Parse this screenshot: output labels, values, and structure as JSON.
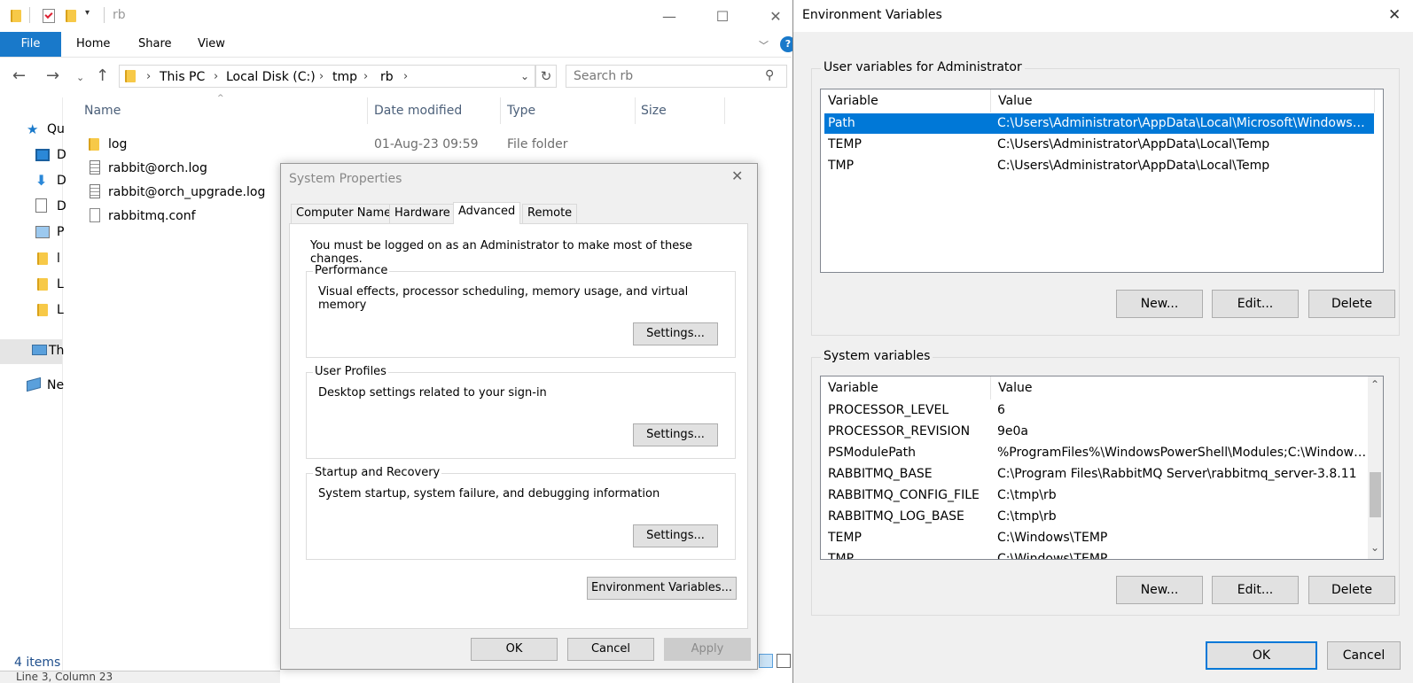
{
  "explorer": {
    "title": "rb",
    "ribbon_tabs": [
      "File",
      "Home",
      "Share",
      "View"
    ],
    "help_icon": "?",
    "breadcrumbs": [
      "This PC",
      "Local Disk (C:)",
      "tmp",
      "rb"
    ],
    "search_placeholder": "Search rb",
    "columns": [
      "Name",
      "Date modified",
      "Type",
      "Size"
    ],
    "files": [
      {
        "name": "log",
        "date": "01-Aug-23 09:59",
        "type": "File folder",
        "icon": "folder-icon"
      },
      {
        "name": "rabbit@orch.log",
        "date": "",
        "type": "",
        "icon": "text-file-icon"
      },
      {
        "name": "rabbit@orch_upgrade.log",
        "date": "",
        "type": "",
        "icon": "text-file-icon"
      },
      {
        "name": "rabbitmq.conf",
        "date": "",
        "type": "",
        "icon": "blank-file-icon"
      }
    ],
    "nav_items": [
      {
        "label": "Qu",
        "icon": "star-icon"
      },
      {
        "label": "D",
        "icon": "desktop-icon"
      },
      {
        "label": "D",
        "icon": "download-icon"
      },
      {
        "label": "D",
        "icon": "document-icon"
      },
      {
        "label": "P",
        "icon": "pictures-icon"
      },
      {
        "label": "l",
        "icon": "folder-icon"
      },
      {
        "label": "L",
        "icon": "folder-icon"
      },
      {
        "label": "L",
        "icon": "folder-icon"
      },
      {
        "label": "Th",
        "icon": "computer-icon"
      },
      {
        "label": "Ne",
        "icon": "network-icon"
      }
    ],
    "status_items": "4 items",
    "bottom_text": "Line 3, Column 23"
  },
  "system_properties": {
    "title": "System Properties",
    "tabs": [
      "Computer Name",
      "Hardware",
      "Advanced",
      "Remote"
    ],
    "active_tab": "Advanced",
    "admin_note": "You must be logged on as an Administrator to make most of these changes.",
    "groups": [
      {
        "title": "Performance",
        "desc": "Visual effects, processor scheduling, memory usage, and virtual memory",
        "button": "Settings..."
      },
      {
        "title": "User Profiles",
        "desc": "Desktop settings related to your sign-in",
        "button": "Settings..."
      },
      {
        "title": "Startup and Recovery",
        "desc": "System startup, system failure, and debugging information",
        "button": "Settings..."
      }
    ],
    "env_button": "Environment Variables...",
    "ok": "OK",
    "cancel": "Cancel",
    "apply": "Apply"
  },
  "environment_variables": {
    "title": "Environment Variables",
    "user_section_title": "User variables for Administrator",
    "system_section_title": "System variables",
    "col_variable": "Variable",
    "col_value": "Value",
    "user_vars": [
      {
        "name": "Path",
        "value": "C:\\Users\\Administrator\\AppData\\Local\\Microsoft\\WindowsA..."
      },
      {
        "name": "TEMP",
        "value": "C:\\Users\\Administrator\\AppData\\Local\\Temp"
      },
      {
        "name": "TMP",
        "value": "C:\\Users\\Administrator\\AppData\\Local\\Temp"
      }
    ],
    "selected_user_var": "Path",
    "system_vars": [
      {
        "name": "PROCESSOR_LEVEL",
        "value": "6"
      },
      {
        "name": "PROCESSOR_REVISION",
        "value": "9e0a"
      },
      {
        "name": "PSModulePath",
        "value": "%ProgramFiles%\\WindowsPowerShell\\Modules;C:\\Windows\\s..."
      },
      {
        "name": "RABBITMQ_BASE",
        "value": "C:\\Program Files\\RabbitMQ Server\\rabbitmq_server-3.8.11"
      },
      {
        "name": "RABBITMQ_CONFIG_FILE",
        "value": "C:\\tmp\\rb"
      },
      {
        "name": "RABBITMQ_LOG_BASE",
        "value": "C:\\tmp\\rb"
      },
      {
        "name": "TEMP",
        "value": "C:\\Windows\\TEMP"
      },
      {
        "name": "TMP",
        "value": "C:\\Windows\\TEMP"
      }
    ],
    "new_button": "New...",
    "edit_button": "Edit...",
    "delete_button": "Delete",
    "ok": "OK",
    "cancel": "Cancel",
    "close_glyph": "✕",
    "accent": "#0078d7"
  }
}
